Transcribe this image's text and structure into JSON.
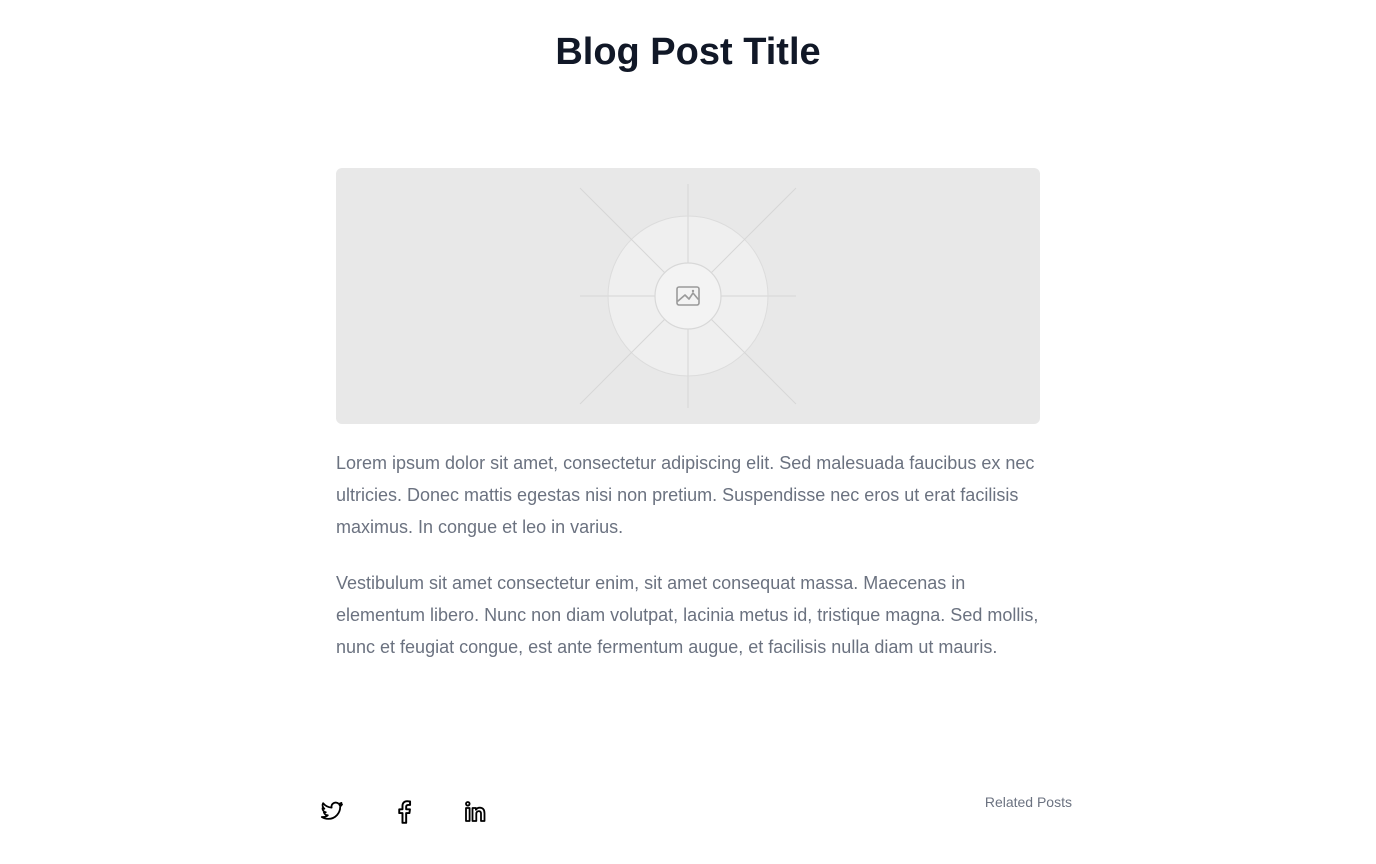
{
  "post": {
    "title": "Blog Post Title",
    "image_icon": "image-icon",
    "paragraphs": [
      "Lorem ipsum dolor sit amet, consectetur adipiscing elit. Sed malesuada faucibus ex nec ultricies. Donec mattis egestas nisi non pretium. Suspendisse nec eros ut erat facilisis maximus. In congue et leo in varius.",
      "Vestibulum sit amet consectetur enim, sit amet consequat massa. Maecenas in elementum libero. Nunc non diam volutpat, lacinia metus id, tristique magna. Sed mollis, nunc et feugiat congue, est ante fermentum augue, et facilisis nulla diam ut mauris."
    ]
  },
  "footer": {
    "social_icons": [
      "twitter-icon",
      "facebook-icon",
      "linkedin-icon"
    ],
    "related_posts_label": "Related Posts"
  },
  "colors": {
    "title": "#111827",
    "body_text": "#6b7280",
    "placeholder_bg": "#e8e8e8"
  }
}
